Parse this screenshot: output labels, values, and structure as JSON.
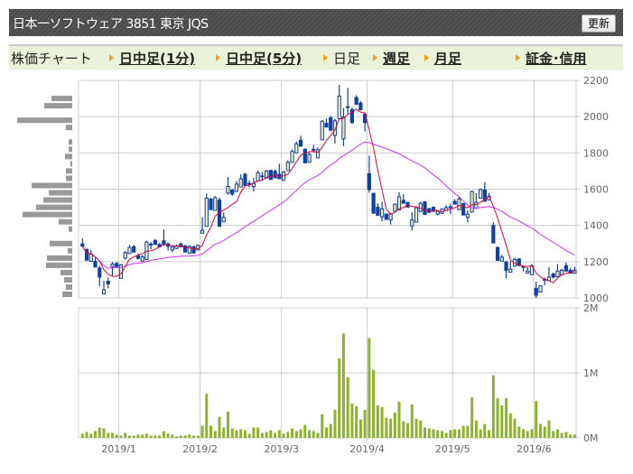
{
  "header": {
    "title": "日本一ソフトウェア  3851  東京 JQS",
    "refresh_label": "更新"
  },
  "nav": {
    "label": "株価チャート",
    "items": [
      {
        "label": "日中足(1分)",
        "link": true
      },
      {
        "label": "日中足(5分)",
        "link": true
      },
      {
        "label": "日足",
        "link": false
      },
      {
        "label": "週足",
        "link": true
      },
      {
        "label": "月足",
        "link": true
      },
      {
        "label": "証金･信用",
        "link": true
      }
    ]
  },
  "colors": {
    "up_fill": "#f4efb4",
    "candle": "#1040a0",
    "ma_short": "#e0003c",
    "ma_long": "#cc33ff",
    "volume": "#8db32e",
    "profile": "#999999",
    "grid": "#cccccc"
  },
  "chart_data": [
    {
      "type": "candlestick",
      "ylim": [
        1000,
        2200
      ],
      "y_ticks": [
        "2200",
        "2000",
        "1800",
        "1600",
        "1400",
        "1200",
        "1000"
      ],
      "x_ticks": [
        {
          "label": "2019/1",
          "index": 9
        },
        {
          "label": "2019/2",
          "index": 28
        },
        {
          "label": "2019/3",
          "index": 47
        },
        {
          "label": "2019/4",
          "index": 67
        },
        {
          "label": "2019/5",
          "index": 87
        },
        {
          "label": "2019/6",
          "index": 106
        }
      ],
      "moving_averages": [
        5,
        25
      ],
      "ohlc": [
        [
          1298,
          1328,
          1285,
          1285
        ],
        [
          1268,
          1272,
          1208,
          1208
        ],
        [
          1202,
          1265,
          1202,
          1242
        ],
        [
          1202,
          1223,
          1170,
          1170
        ],
        [
          1165,
          1178,
          1065,
          1115
        ],
        [
          1023,
          1095,
          1023,
          1045
        ],
        [
          1092,
          1112,
          1053,
          1078
        ],
        [
          1173,
          1198,
          1123,
          1187
        ],
        [
          1190,
          1198,
          1170,
          1173
        ],
        [
          1108,
          1187,
          1108,
          1182
        ],
        [
          1220,
          1258,
          1212,
          1250
        ],
        [
          1245,
          1292,
          1245,
          1278
        ],
        [
          1283,
          1292,
          1253,
          1253
        ],
        [
          1232,
          1245,
          1212,
          1218
        ],
        [
          1203,
          1237,
          1203,
          1227
        ],
        [
          1212,
          1315,
          1212,
          1308
        ],
        [
          1297,
          1308,
          1268,
          1297
        ],
        [
          1317,
          1325,
          1295,
          1295
        ],
        [
          1295,
          1302,
          1282,
          1282
        ],
        [
          1315,
          1378,
          1287,
          1298
        ],
        [
          1298,
          1305,
          1262,
          1285
        ],
        [
          1265,
          1290,
          1253,
          1282
        ],
        [
          1273,
          1295,
          1270,
          1287
        ],
        [
          1298,
          1305,
          1282,
          1282
        ],
        [
          1287,
          1292,
          1253,
          1253
        ],
        [
          1248,
          1290,
          1242,
          1285
        ],
        [
          1282,
          1288,
          1248,
          1248
        ],
        [
          1265,
          1295,
          1262,
          1290
        ],
        [
          1357,
          1445,
          1357,
          1373
        ],
        [
          1395,
          1575,
          1395,
          1550
        ],
        [
          1545,
          1552,
          1487,
          1487
        ],
        [
          1483,
          1562,
          1483,
          1553
        ],
        [
          1540,
          1553,
          1395,
          1395
        ],
        [
          1420,
          1470,
          1420,
          1445
        ],
        [
          1578,
          1667,
          1570,
          1615
        ],
        [
          1595,
          1600,
          1562,
          1573
        ],
        [
          1587,
          1645,
          1587,
          1628
        ],
        [
          1612,
          1682,
          1612,
          1657
        ],
        [
          1682,
          1690,
          1620,
          1620
        ],
        [
          1632,
          1648,
          1612,
          1632
        ],
        [
          1615,
          1662,
          1587,
          1632
        ],
        [
          1645,
          1703,
          1645,
          1690
        ],
        [
          1673,
          1695,
          1645,
          1673
        ],
        [
          1662,
          1705,
          1662,
          1700
        ],
        [
          1703,
          1708,
          1653,
          1653
        ],
        [
          1698,
          1708,
          1662,
          1662
        ],
        [
          1682,
          1740,
          1658,
          1658
        ],
        [
          1648,
          1700,
          1648,
          1695
        ],
        [
          1703,
          1758,
          1703,
          1748
        ],
        [
          1748,
          1820,
          1748,
          1808
        ],
        [
          1800,
          1862,
          1800,
          1850
        ],
        [
          1870,
          1895,
          1837,
          1837
        ],
        [
          1820,
          1825,
          1745,
          1745
        ],
        [
          1748,
          1800,
          1748,
          1792
        ],
        [
          1820,
          1845,
          1803,
          1820
        ],
        [
          1772,
          1830,
          1772,
          1817
        ],
        [
          1872,
          1980,
          1872,
          1975
        ],
        [
          1963,
          1988,
          1942,
          1942
        ],
        [
          1993,
          2005,
          1925,
          1925
        ],
        [
          1897,
          1988,
          1852,
          1977
        ],
        [
          1988,
          2175,
          1988,
          2113
        ],
        [
          1877,
          2047,
          1838,
          1997
        ],
        [
          2055,
          2158,
          2018,
          2055
        ],
        [
          2038,
          2052,
          1958,
          1968
        ],
        [
          2105,
          2118,
          2068,
          2068
        ],
        [
          2075,
          2085,
          2038,
          2038
        ],
        [
          2013,
          2025,
          1918,
          1967
        ],
        [
          1685,
          1785,
          1580,
          1597
        ],
        [
          1577,
          1580,
          1467,
          1467
        ],
        [
          1500,
          1522,
          1455,
          1455
        ],
        [
          1447,
          1530,
          1422,
          1492
        ],
        [
          1463,
          1465,
          1433,
          1433
        ],
        [
          1430,
          1470,
          1405,
          1463
        ],
        [
          1478,
          1522,
          1478,
          1517
        ],
        [
          1485,
          1583,
          1485,
          1558
        ],
        [
          1538,
          1572,
          1520,
          1522
        ],
        [
          1527,
          1530,
          1500,
          1500
        ],
        [
          1397,
          1472,
          1372,
          1430
        ],
        [
          1418,
          1505,
          1418,
          1497
        ],
        [
          1477,
          1530,
          1477,
          1522
        ],
        [
          1530,
          1535,
          1460,
          1460
        ],
        [
          1492,
          1498,
          1472,
          1472
        ],
        [
          1500,
          1505,
          1478,
          1478
        ],
        [
          1462,
          1485,
          1455,
          1478
        ],
        [
          1467,
          1495,
          1462,
          1490
        ],
        [
          1483,
          1512,
          1483,
          1498
        ],
        [
          1503,
          1520,
          1462,
          1503
        ],
        [
          1532,
          1545,
          1517,
          1517
        ],
        [
          1487,
          1560,
          1487,
          1545
        ],
        [
          1520,
          1525,
          1457,
          1457
        ],
        [
          1445,
          1483,
          1418,
          1462
        ],
        [
          1473,
          1592,
          1473,
          1587
        ],
        [
          1495,
          1578,
          1495,
          1528
        ],
        [
          1550,
          1603,
          1550,
          1598
        ],
        [
          1595,
          1637,
          1533,
          1533
        ],
        [
          1540,
          1578,
          1540,
          1562
        ],
        [
          1400,
          1418,
          1303,
          1303
        ],
        [
          1278,
          1285,
          1207,
          1207
        ],
        [
          1203,
          1237,
          1203,
          1225
        ],
        [
          1198,
          1205,
          1107,
          1153
        ],
        [
          1142,
          1203,
          1142,
          1158
        ],
        [
          1175,
          1223,
          1175,
          1212
        ],
        [
          1215,
          1220,
          1178,
          1178
        ],
        [
          1173,
          1180,
          1145,
          1173
        ],
        [
          1137,
          1170,
          1137,
          1148
        ],
        [
          1128,
          1187,
          1128,
          1178
        ],
        [
          1053,
          1090,
          1000,
          1015
        ],
        [
          1033,
          1070,
          1033,
          1067
        ],
        [
          1103,
          1112,
          1070,
          1103
        ],
        [
          1095,
          1170,
          1095,
          1115
        ],
        [
          1132,
          1140,
          1108,
          1115
        ],
        [
          1117,
          1187,
          1117,
          1148
        ],
        [
          1128,
          1160,
          1128,
          1153
        ],
        [
          1178,
          1195,
          1148,
          1148
        ],
        [
          1153,
          1165,
          1137,
          1137
        ],
        [
          1137,
          1173,
          1137,
          1153
        ]
      ]
    },
    {
      "type": "bar",
      "title": "volume",
      "ylim": [
        0,
        2000000
      ],
      "y_ticks": [
        "2M",
        "1M",
        "0M"
      ],
      "values_thousands": [
        64,
        91,
        64,
        105,
        159,
        145,
        77,
        77,
        50,
        36,
        77,
        36,
        36,
        50,
        50,
        64,
        36,
        36,
        36,
        105,
        64,
        50,
        23,
        36,
        36,
        50,
        36,
        36,
        186,
        677,
        186,
        105,
        323,
        159,
        405,
        145,
        118,
        132,
        118,
        64,
        159,
        159,
        77,
        91,
        118,
        77,
        118,
        64,
        91,
        145,
        105,
        132,
        200,
        118,
        105,
        77,
        364,
        159,
        214,
        432,
        1223,
        1605,
        936,
        527,
        486,
        282,
        432,
        1536,
        1045,
        500,
        473,
        309,
        295,
        391,
        555,
        255,
        227,
        514,
        295,
        268,
        159,
        145,
        132,
        118,
        105,
        77,
        118,
        132,
        132,
        186,
        186,
        623,
        268,
        132,
        214,
        118,
        964,
        609,
        500,
        609,
        377,
        295,
        173,
        132,
        105,
        132,
        568,
        214,
        173,
        268,
        105,
        132,
        77,
        91,
        50,
        50
      ]
    },
    {
      "type": "bar",
      "title": "price-by-volume",
      "orientation": "horizontal",
      "bin_start": 1000,
      "bin_size": 40,
      "relative_values": [
        11,
        7,
        9,
        13,
        29,
        28,
        5,
        25,
        0,
        4,
        15,
        55,
        40,
        32,
        26,
        45,
        7,
        7,
        2,
        8,
        4,
        4,
        0,
        7,
        61,
        0,
        31,
        23
      ]
    }
  ]
}
